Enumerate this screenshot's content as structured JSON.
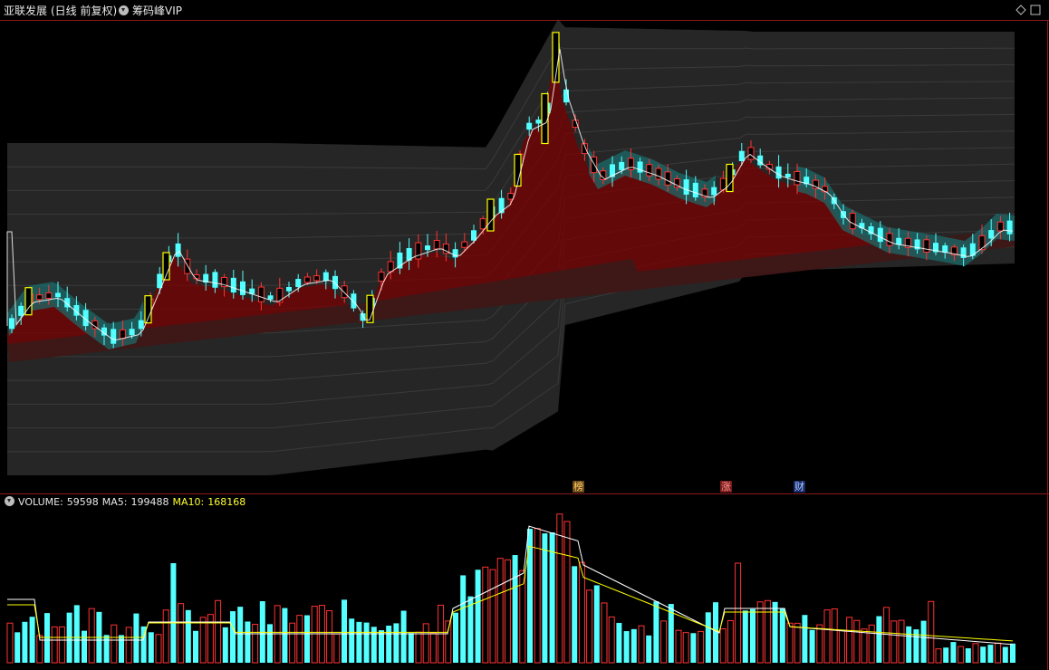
{
  "title": {
    "stock": "亚联发展",
    "period": "(日线 前复权)",
    "indicator": "筹码峰VIP"
  },
  "tags": [
    {
      "label": "榜",
      "bg": "#6b4a1e",
      "color": "#ffcc66"
    },
    {
      "label": "涨",
      "bg": "#7a1a1a",
      "color": "#ff9999"
    },
    {
      "label": "财",
      "bg": "#1a2a6a",
      "color": "#aaccff"
    }
  ],
  "volume": {
    "name": "VOLUME:",
    "value": "59598",
    "ma5_label": "MA5:",
    "ma5": "199488",
    "ma10_label": "MA10:",
    "ma10": "168168"
  },
  "colors": {
    "up": "#ff3333",
    "down": "#54ffff",
    "limit_up_box": "#ffff00",
    "ma5": "#ffffff",
    "ma10": "#ffff00",
    "chip_red": "#7a0000",
    "chip_cyan": "#1a6f6f",
    "frame": "#8a1a1a"
  },
  "icons": [
    "dropdown-circle-icon",
    "diamond-icon",
    "square-icon"
  ]
}
